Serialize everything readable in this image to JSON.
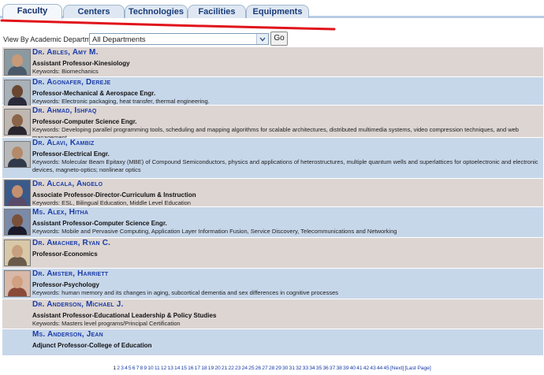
{
  "tabs": [
    {
      "label": "Faculty",
      "active": true
    },
    {
      "label": "Centers",
      "active": false
    },
    {
      "label": "Technologies",
      "active": false
    },
    {
      "label": "Facilities",
      "active": false
    },
    {
      "label": "Equipments",
      "active": false
    }
  ],
  "filter": {
    "label": "View By Academic Department:",
    "selected": "All Departments",
    "go_label": "Go"
  },
  "faculty": [
    {
      "name": "Dr. Ables, Amy M.",
      "title": "Assistant Professor-Kinesiology",
      "keywords": "Keywords: Biomechanics",
      "photo": true,
      "stripe": "pink"
    },
    {
      "name": "Dr. Agonafer, Dereje",
      "title": "Professor-Mechanical & Aerospace Engr.",
      "keywords": "Keywords: Electronic packaging, heat transfer, thermal engineering.",
      "photo": true,
      "stripe": "blue"
    },
    {
      "name": "Dr. Ahmad, Ishfaq",
      "title": "Professor-Computer Science Engr.",
      "keywords": "Keywords: Developing parallel programming tools, scheduling and mapping algorithms for scalable architectures, distributed multimedia systems, video compression techniques, and web management",
      "photo": true,
      "stripe": "pink"
    },
    {
      "name": "Dr. Alavi, Kambiz",
      "title": "Professor-Electrical Engr.",
      "keywords": "Keywords: Molecular Beam Epitaxy (MBE) of Compound Semiconductors, physics and applications of heterostructures, multiple quantum wells and superlattices for optoelectronic and electronic devices, magneto-optics; nonlinear optics",
      "photo": true,
      "stripe": "blue"
    },
    {
      "name": "Dr. Alcala, Angelo",
      "title": "Associate Professor-Director-Curriculum & Instruction",
      "keywords": "Keywords: ESL, Bilingual Education, Middle Level Education",
      "photo": true,
      "stripe": "pink"
    },
    {
      "name": "Ms. Alex, Hitha",
      "title": "Assistant Professor-Computer Science Engr.",
      "keywords": "Keywords: Mobile and Pervasive Computing, Application Layer Information Fusion, Service Discovery, Telecommunications and Networking",
      "photo": true,
      "stripe": "blue"
    },
    {
      "name": "Dr. Amacher, Ryan C.",
      "title": "Professor-Economics",
      "keywords": "",
      "photo": true,
      "stripe": "pink"
    },
    {
      "name": "Dr. Amster, Harriett",
      "title": "Professor-Psychology",
      "keywords": "Keywords: human memory and its changes in aging, subcortical dementia and sex differences in cognitive processes",
      "photo": true,
      "stripe": "blue"
    },
    {
      "name": "Dr. Anderson, Michael J.",
      "title": "Assistant Professor-Educational Leadership & Policy Studies",
      "keywords": "Keywords: Masters level programs/Principal Certification",
      "photo": false,
      "stripe": "pink"
    },
    {
      "name": "Ms. Anderson, Jean",
      "title": "Adjunct Professor-College of Education",
      "keywords": "",
      "photo": false,
      "stripe": "blue"
    }
  ],
  "pagination": {
    "pages": [
      "1",
      "2",
      "3",
      "4",
      "5",
      "6",
      "7",
      "8",
      "9",
      "10",
      "11",
      "12",
      "13",
      "14",
      "15",
      "16",
      "17",
      "18",
      "19",
      "20",
      "21",
      "22",
      "23",
      "24",
      "25",
      "26",
      "27",
      "28",
      "29",
      "30",
      "31",
      "32",
      "33",
      "34",
      "35",
      "36",
      "37",
      "38",
      "39",
      "40",
      "41",
      "42",
      "43",
      "44",
      "45"
    ],
    "next": "[Next]",
    "last": "[Last Page]",
    "current": "1"
  },
  "colors": {
    "stripe_pink": "#dcd5d2",
    "stripe_blue": "#c7d7ea",
    "link": "#1a3ca8",
    "annotation": "#e0141a"
  }
}
